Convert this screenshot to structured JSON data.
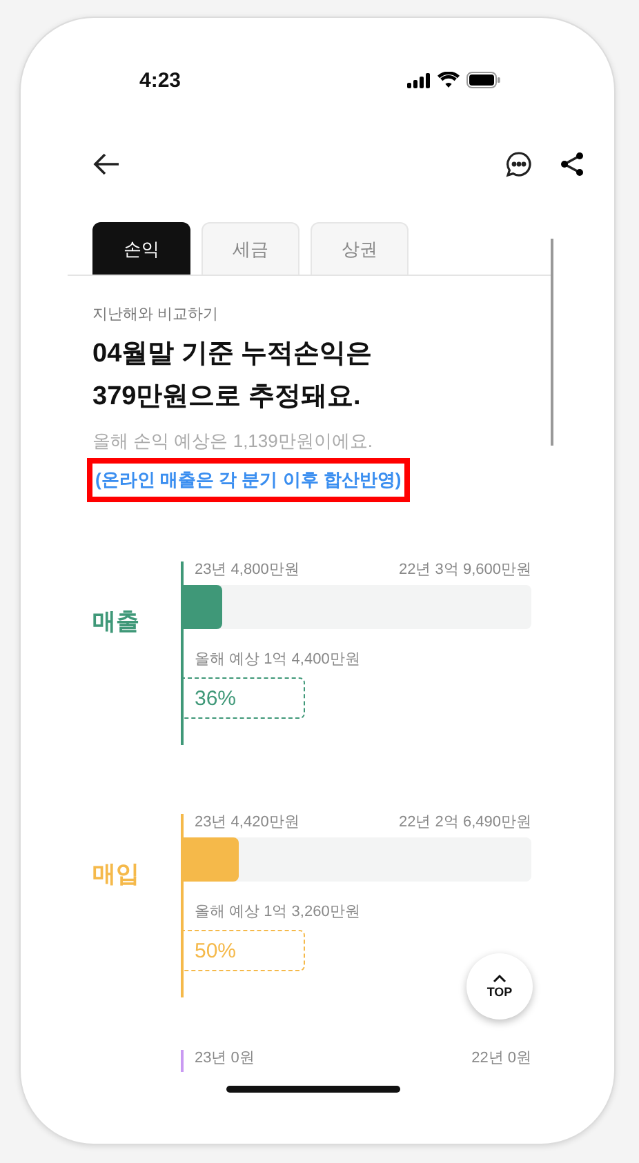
{
  "status_bar": {
    "time": "4:23"
  },
  "tabs": [
    {
      "label": "손익",
      "selected": true
    },
    {
      "label": "세금",
      "selected": false
    },
    {
      "label": "상권",
      "selected": false
    }
  ],
  "intro": {
    "caption": "지난해와 비교하기",
    "headline_lines": [
      "04월말 기준 누적손익은",
      "379만원으로 추정돼요."
    ],
    "summary": "올해 손익 예상은 1,139만원이에요.",
    "note": {
      "text": "(온라인 매출은 각 분기 이후 합산반영)",
      "highlighted": true
    }
  },
  "metrics": [
    {
      "label": "매출",
      "color": "#3f9878",
      "this_year": "23년 4,800만원",
      "last_year": "22년 3억 9,600만원",
      "level": 0.12,
      "forecast": "올해 예상 1억 4,400만원",
      "percent": "36%"
    },
    {
      "label": "매입",
      "color": "#f5b94a",
      "this_year": "23년 4,420만원",
      "last_year": "22년 2억 6,490만원",
      "level": 0.165,
      "forecast": "올해 예상 1억 3,260만원",
      "percent": "50%"
    },
    {
      "color": "#c99af2",
      "this_year": "23년 0원",
      "last_year": "22년 0원"
    }
  ],
  "top_button": {
    "label": "TOP"
  }
}
